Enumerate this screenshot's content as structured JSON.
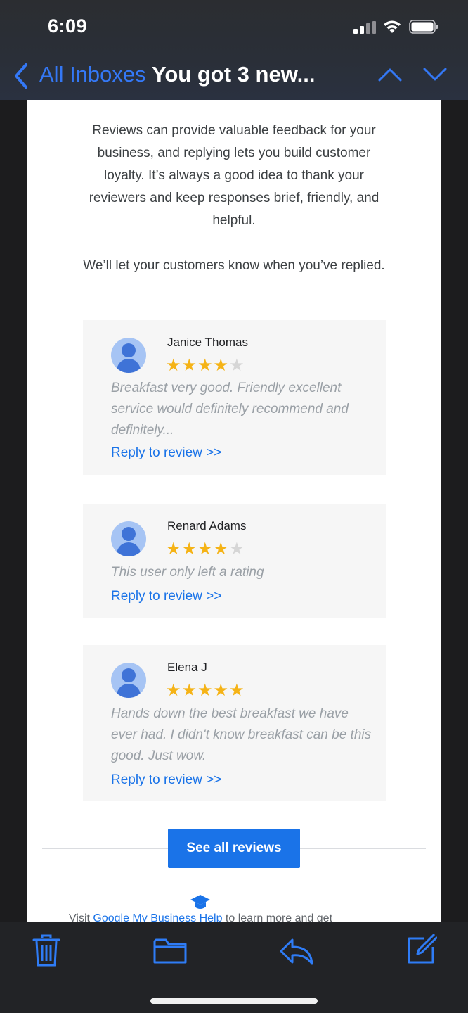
{
  "status_bar": {
    "time": "6:09"
  },
  "nav": {
    "back_label": "All Inboxes",
    "subject": "You got 3 new..."
  },
  "email": {
    "intro": "Reviews can provide valuable feedback for your business, and replying lets you build customer loyalty. It’s always a good idea to thank your reviewers and keep responses brief, friendly, and helpful.",
    "intro2": "We’ll let your customers know when you’ve replied.",
    "reviews": [
      {
        "name": "Janice Thomas",
        "rating": 4,
        "max_rating": 5,
        "text": "Breakfast very good. Friendly excellent service would definitely recommend and definitely...",
        "reply_label": "Reply to review >>"
      },
      {
        "name": "Renard Adams",
        "rating": 4,
        "max_rating": 5,
        "text": "This user only left a rating",
        "reply_label": "Reply to review >>"
      },
      {
        "name": "Elena J",
        "rating": 5,
        "max_rating": 5,
        "text": "Hands down the best breakfast we have ever had. I didn't know breakfast can be this good. Just wow.",
        "reply_label": "Reply to review >>"
      }
    ],
    "see_all_label": "See all reviews",
    "help_prefix": "Visit ",
    "help_link": "Google My Business Help",
    "help_suffix": " to learn more and get"
  },
  "toolbar": {
    "icons": [
      "trash-icon",
      "folder-icon",
      "reply-icon",
      "compose-icon"
    ]
  },
  "colors": {
    "accent": "#1a73e8",
    "ios_blue": "#3478f6",
    "star": "#f5b316",
    "star_empty": "#d6d6d6",
    "review_bg": "#f6f6f6"
  }
}
